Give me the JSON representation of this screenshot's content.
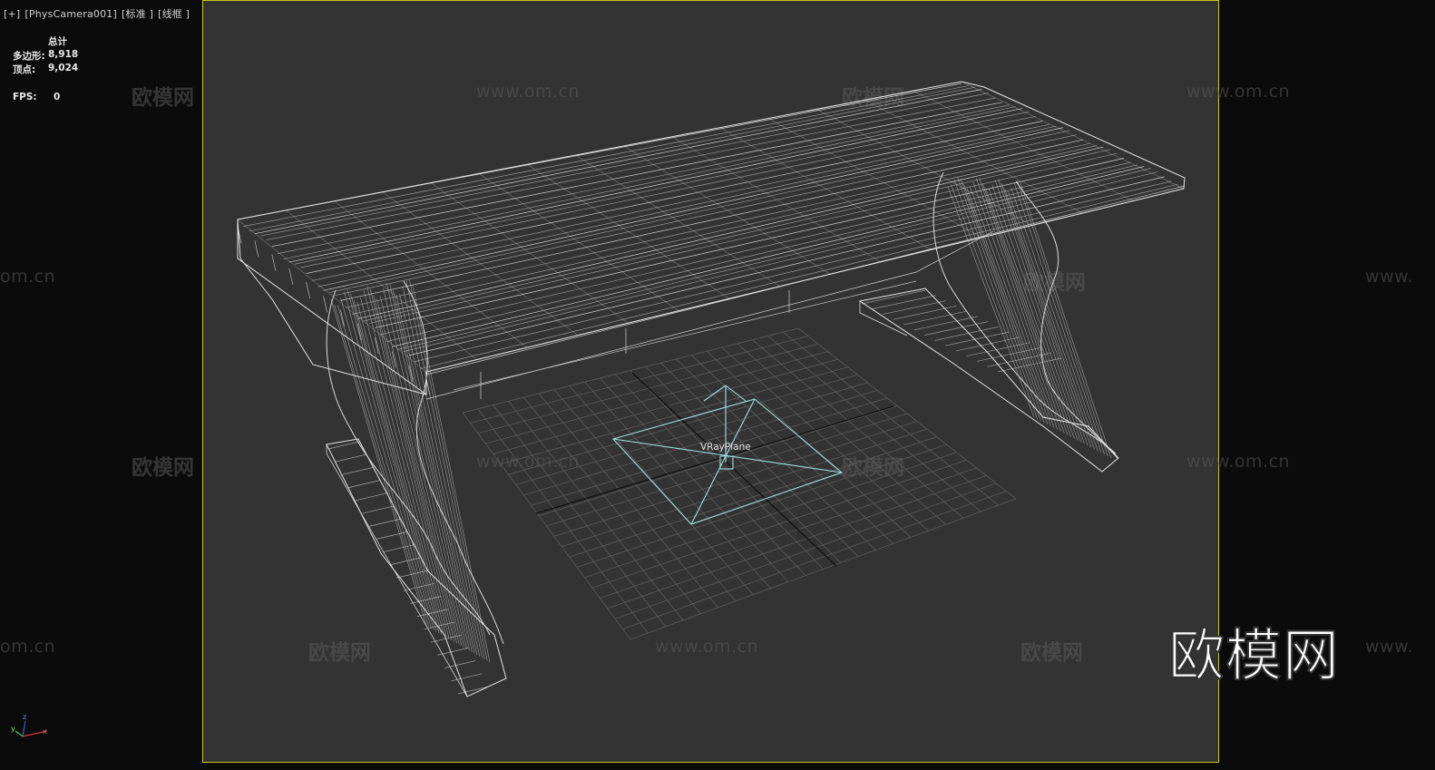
{
  "viewport": {
    "label_items": [
      "[+]",
      "[PhysCamera001]",
      "[标准 ]",
      "[线框 ]"
    ],
    "stats": {
      "header": "总计",
      "polys_label": "多边形:",
      "polys_value": "8,918",
      "verts_label": "顶点:",
      "verts_value": "9,024",
      "fps_label": "FPS:",
      "fps_value": "0"
    },
    "object_label": "VRayPlane",
    "axis": {
      "x": "x",
      "y": "y",
      "z": "z"
    }
  },
  "watermarks": {
    "logo_text": "欧模网",
    "url_text": "www.om.cn",
    "url_partial": "om.cn",
    "www_partial": "www."
  },
  "brand_logo": "欧模网",
  "colors": {
    "background": "#0b0b0b",
    "viewport_bg": "#333333",
    "safe_frame": "#c8c814",
    "wireframe": "#dcdcdc",
    "vray_plane": "#8fd8d8",
    "grid": "#5a5a5a"
  }
}
